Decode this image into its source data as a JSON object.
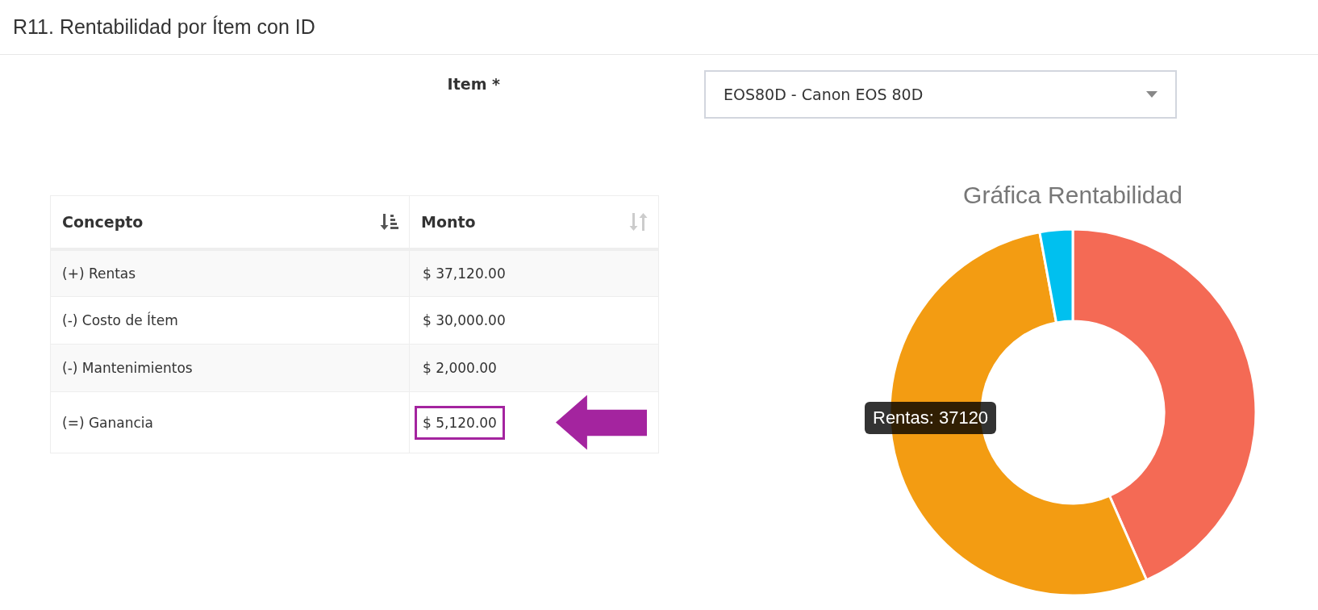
{
  "page": {
    "title": "R11. Rentabilidad por Ítem con ID"
  },
  "form": {
    "label": "Item *",
    "select": {
      "value": "EOS80D - Canon EOS 80D"
    }
  },
  "table": {
    "columns": [
      {
        "label": "Concepto",
        "sorted": true
      },
      {
        "label": "Monto",
        "sorted": false
      }
    ],
    "rows": [
      {
        "concepto": "(+) Rentas",
        "monto": "$ 37,120.00",
        "highlighted": false
      },
      {
        "concepto": "(-) Costo de Ítem",
        "monto": "$ 30,000.00",
        "highlighted": false
      },
      {
        "concepto": "(-) Mantenimientos",
        "monto": "$ 2,000.00",
        "highlighted": false
      },
      {
        "concepto": "(=) Ganancia",
        "monto": "$ 5,120.00",
        "highlighted": true
      }
    ]
  },
  "chart": {
    "tooltip": "Rentas: 37120",
    "chart_data": {
      "type": "donut",
      "title": "Gráfica Rentabilidad",
      "series": [
        {
          "values": [
            43.4,
            53.7,
            2.9
          ],
          "colors": [
            "#f46a55",
            "#f39c12",
            "#00c0ef"
          ]
        }
      ]
    }
  }
}
